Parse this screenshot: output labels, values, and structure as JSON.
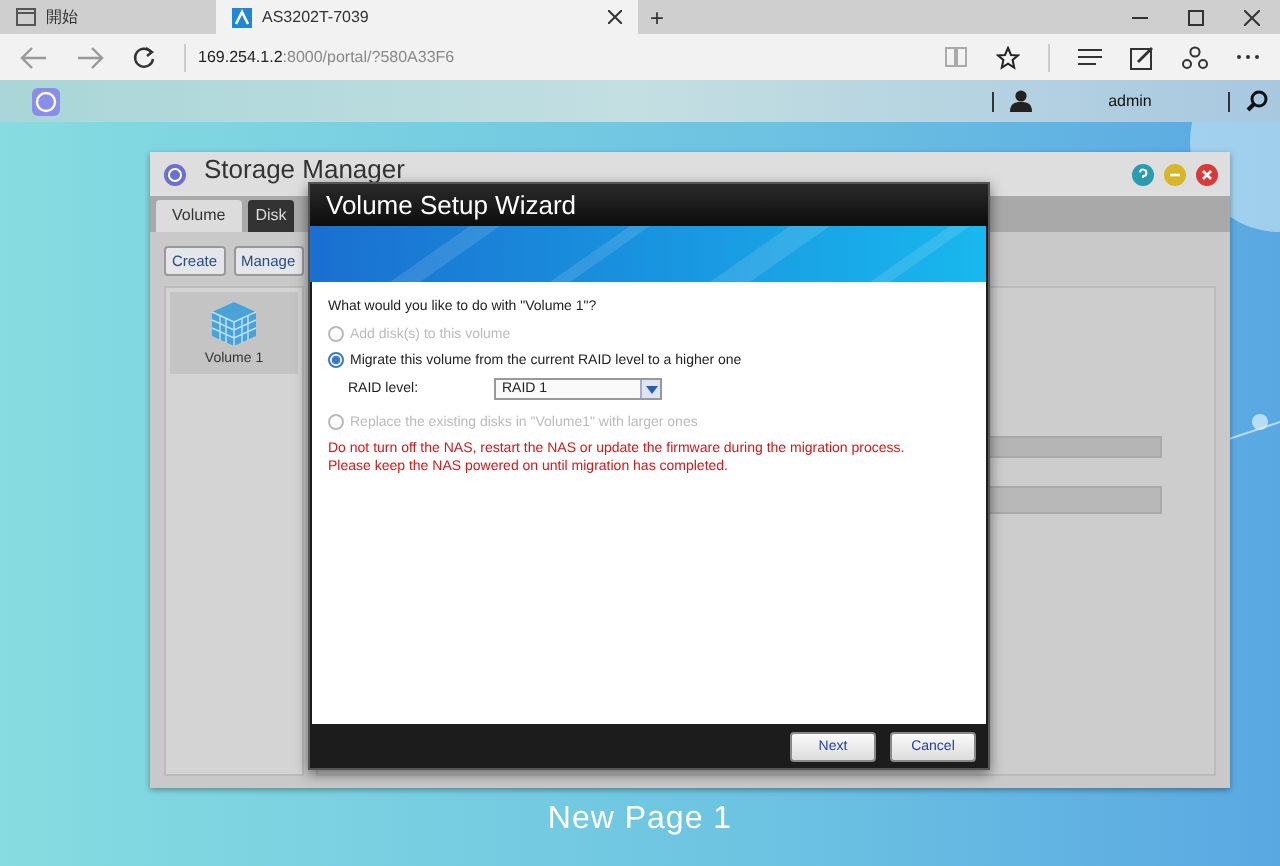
{
  "browser": {
    "tabs": [
      {
        "label": "開始",
        "selected": false
      },
      {
        "label": "AS3202T-7039",
        "selected": true
      }
    ],
    "new_tab": "+",
    "address": {
      "host": "169.254.1.2",
      "path": ":8000/portal/?580A33F6"
    }
  },
  "topbar": {
    "user": "admin"
  },
  "storage_manager": {
    "title": "Storage Manager",
    "tabs": [
      {
        "label": "Volume",
        "selected": true
      },
      {
        "label": "Disk",
        "selected": false
      }
    ],
    "toolbar": [
      "Create",
      "Manage"
    ],
    "volumes": [
      "Volume 1"
    ]
  },
  "wizard": {
    "title": "Volume Setup Wizard",
    "question": "What would you like to do with \"Volume 1\"?",
    "options": [
      {
        "label": "Add disk(s) to this volume",
        "selected": false,
        "disabled": true
      },
      {
        "label": "Migrate this volume from the current RAID level to a higher one",
        "selected": true,
        "disabled": false,
        "raid": {
          "label": "RAID level:",
          "value": "RAID 1"
        }
      },
      {
        "label": "Replace the existing disks in \"Volume1\" with larger ones",
        "selected": false,
        "disabled": true
      }
    ],
    "warning": "Do not turn off the NAS, restart the NAS or update the firmware during the migration process. Please keep the NAS powered on until migration has completed.",
    "buttons": [
      "Next",
      "Cancel"
    ]
  },
  "page_label": "New Page 1"
}
